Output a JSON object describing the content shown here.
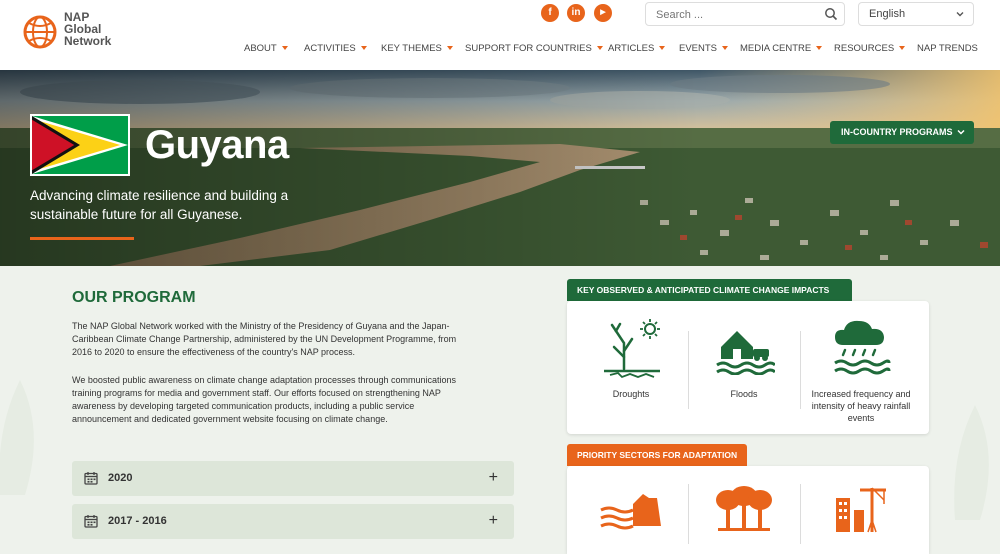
{
  "brand": {
    "line1": "NAP",
    "line2": "Global",
    "line3": "Network"
  },
  "social": [
    {
      "icon": "facebook-icon",
      "glyph": "f"
    },
    {
      "icon": "linkedin-icon",
      "glyph": "in"
    },
    {
      "icon": "youtube-icon",
      "glyph": "▶"
    }
  ],
  "search": {
    "placeholder": "Search ..."
  },
  "language": {
    "selected": "English"
  },
  "nav": [
    {
      "label": "ABOUT",
      "dropdown": true
    },
    {
      "label": "ACTIVITIES",
      "dropdown": true
    },
    {
      "label": "KEY THEMES",
      "dropdown": true
    },
    {
      "label": "SUPPORT FOR COUNTRIES",
      "dropdown": true
    },
    {
      "label": "ARTICLES",
      "dropdown": true
    },
    {
      "label": "EVENTS",
      "dropdown": true
    },
    {
      "label": "MEDIA CENTRE",
      "dropdown": true
    },
    {
      "label": "RESOURCES",
      "dropdown": true
    },
    {
      "label": "NAP TRENDS",
      "dropdown": false
    }
  ],
  "hero": {
    "title": "Guyana",
    "subtitle": "Advancing climate resilience and building a sustainable future for all Guyanese.",
    "in_country_button": "IN-COUNTRY PROGRAMS"
  },
  "program": {
    "title": "OUR PROGRAM",
    "paragraph1": "The NAP Global Network worked with the Ministry of the Presidency of Guyana and the Japan-Caribbean Climate Change Partnership, administered by the UN Development Programme, from 2016 to 2020 to ensure the effectiveness of the country's NAP process.",
    "paragraph2": "We boosted public awareness on climate change adaptation processes through communications training programs for media and government staff. Our efforts focused on strengthening NAP awareness by developing targeted communication products, including a public service announcement and dedicated government website focusing on climate change.",
    "accordion": [
      {
        "label": "2020"
      },
      {
        "label": "2017 - 2016"
      }
    ]
  },
  "impacts": {
    "title": "KEY OBSERVED & ANTICIPATED CLIMATE CHANGE IMPACTS",
    "items": [
      {
        "label": "Droughts",
        "icon": "drought-icon"
      },
      {
        "label": "Floods",
        "icon": "flood-icon"
      },
      {
        "label": "Increased frequency and intensity of heavy rainfall events",
        "icon": "heavy-rain-icon"
      }
    ]
  },
  "sectors": {
    "title": "PRIORITY SECTORS FOR ADAPTATION",
    "items": [
      {
        "icon": "coastal-zone-icon"
      },
      {
        "icon": "forestry-icon"
      },
      {
        "icon": "infrastructure-icon"
      }
    ]
  },
  "colors": {
    "accent": "#e8641b",
    "green": "#1f6a3a",
    "background": "#eef2ec"
  }
}
